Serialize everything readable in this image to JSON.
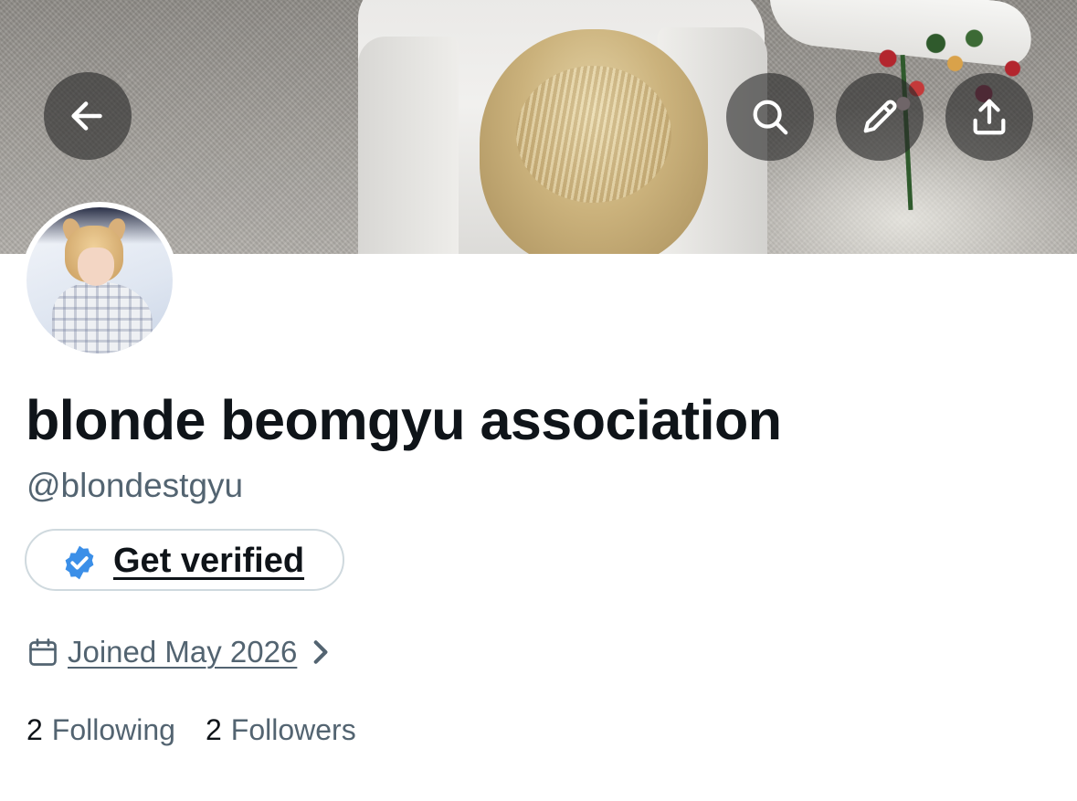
{
  "header": {
    "back_icon": "arrow-left-icon",
    "search_icon": "search-icon",
    "edit_icon": "pencil-icon",
    "share_icon": "share-upload-icon"
  },
  "profile": {
    "display_name": "blonde beomgyu association",
    "handle": "@blondestgyu",
    "verify_button_label": "Get verified",
    "verify_badge_color": "#3b8fe8",
    "joined_text": "Joined May 2026",
    "stats": {
      "following_count": "2",
      "following_label": "Following",
      "followers_count": "2",
      "followers_label": "Followers"
    }
  },
  "colors": {
    "primary_text": "#0f1419",
    "secondary_text": "#536471",
    "border": "#cfd9de",
    "overlay_button": "#282828"
  }
}
